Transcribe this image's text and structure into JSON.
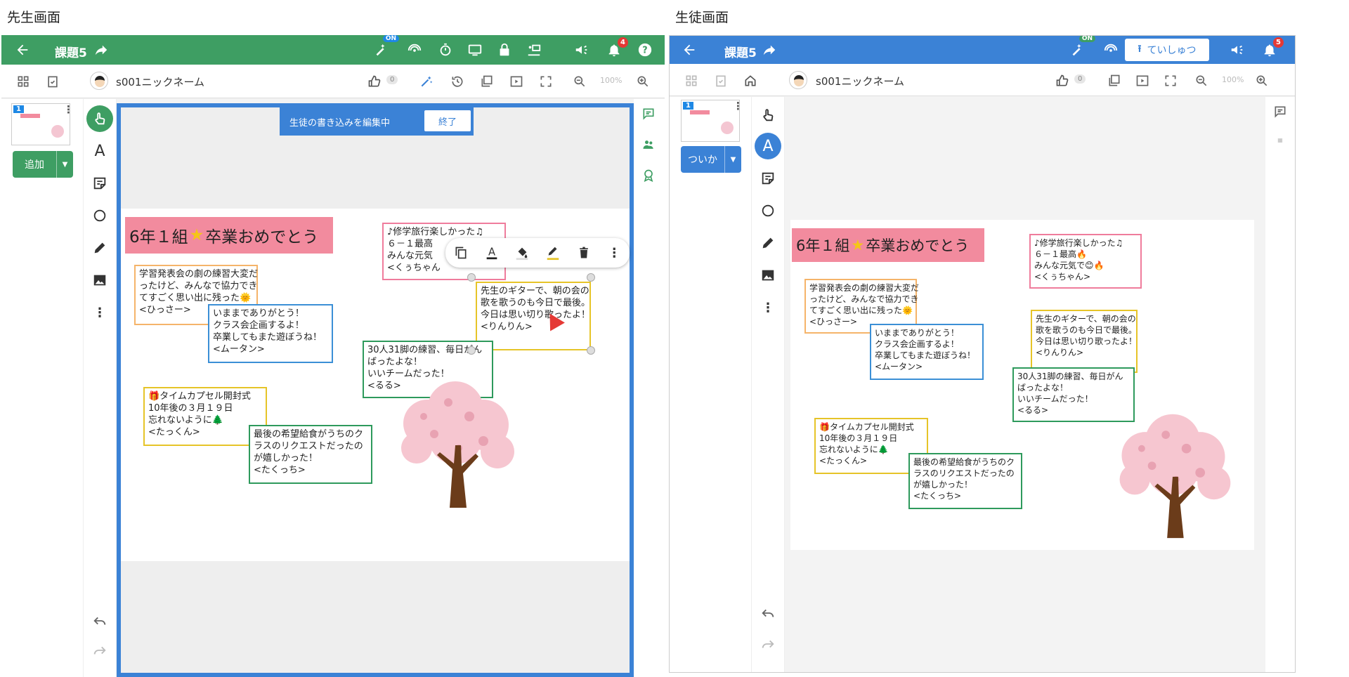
{
  "captions": {
    "teacher": "先生画面",
    "student": "生徒画面"
  },
  "colors": {
    "teacher_accent": "#3e9e63",
    "student_accent": "#3b82d6",
    "add_button": "#3e9e63"
  },
  "teacher": {
    "title": "課題5",
    "on_badge": "ON",
    "notification_count": "4",
    "nickname": "s001ニックネーム",
    "like_count": "0",
    "zoom": "100%",
    "add_button": "追加",
    "editing_banner": "生徒の書き込みを編集中",
    "end_button": "終了",
    "thumb_number": "1"
  },
  "student": {
    "title": "課題5",
    "on_badge": "ON",
    "notification_count": "5",
    "submit_button": "ていしゅつ",
    "nickname": "s001ニックネーム",
    "like_count": "0",
    "zoom": "100%",
    "add_button": "ついか",
    "thumb_number": "1"
  },
  "board": {
    "banner_prefix": "6年１組",
    "banner_suffix": "卒業おめでとう",
    "notes": [
      {
        "id": "hissaa",
        "color": "orange",
        "text": "学習発表会の劇の練習大変だ\nったけど、みんなで協力でき\nてすごく思い出に残った🌞\n<ひっさー>"
      },
      {
        "id": "muutan",
        "color": "blue",
        "text": "いままでありがとう！\nクラス会企画するよ！\n卒業してもまた遊ぼうね！\n<ムータン>"
      },
      {
        "id": "kuuchan",
        "color": "pink",
        "text": "♪修学旅行楽しかった♫\n６－１最高🔥\nみんな元気で😊🔥\n<くぅちゃん>"
      },
      {
        "id": "rinrin",
        "color": "yellow",
        "text": "先生のギターで、朝の会の\n歌を歌うのも今日で最後。\n今日は思い切り歌ったよ！\n<りんりん>"
      },
      {
        "id": "ruru",
        "color": "green",
        "text": "30人31脚の練習、毎日がん\nばったよな！\nいいチームだった！\n<るる>"
      },
      {
        "id": "takkun",
        "color": "yellow",
        "text": "🎁タイムカプセル開封式\n10年後の３月１９日\n忘れないように🌲\n<たっくん>"
      },
      {
        "id": "takucchi",
        "color": "green",
        "text": "最後の希望給食がうちのク\nラスのリクエストだったの\nが嬉しかった！\n<たくっち>"
      }
    ],
    "teacher_kuuchan_text": "♪修学旅行楽しかった♫\n６－１最高\nみんな元気\n<くぅちゃん"
  }
}
